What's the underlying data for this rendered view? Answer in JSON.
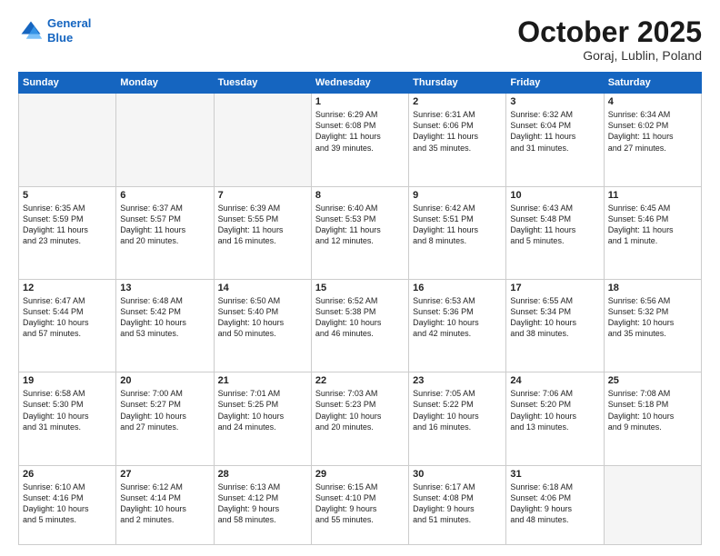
{
  "logo": {
    "line1": "General",
    "line2": "Blue"
  },
  "header": {
    "month": "October 2025",
    "location": "Goraj, Lublin, Poland"
  },
  "weekdays": [
    "Sunday",
    "Monday",
    "Tuesday",
    "Wednesday",
    "Thursday",
    "Friday",
    "Saturday"
  ],
  "weeks": [
    [
      {
        "day": "",
        "content": ""
      },
      {
        "day": "",
        "content": ""
      },
      {
        "day": "",
        "content": ""
      },
      {
        "day": "1",
        "content": "Sunrise: 6:29 AM\nSunset: 6:08 PM\nDaylight: 11 hours\nand 39 minutes."
      },
      {
        "day": "2",
        "content": "Sunrise: 6:31 AM\nSunset: 6:06 PM\nDaylight: 11 hours\nand 35 minutes."
      },
      {
        "day": "3",
        "content": "Sunrise: 6:32 AM\nSunset: 6:04 PM\nDaylight: 11 hours\nand 31 minutes."
      },
      {
        "day": "4",
        "content": "Sunrise: 6:34 AM\nSunset: 6:02 PM\nDaylight: 11 hours\nand 27 minutes."
      }
    ],
    [
      {
        "day": "5",
        "content": "Sunrise: 6:35 AM\nSunset: 5:59 PM\nDaylight: 11 hours\nand 23 minutes."
      },
      {
        "day": "6",
        "content": "Sunrise: 6:37 AM\nSunset: 5:57 PM\nDaylight: 11 hours\nand 20 minutes."
      },
      {
        "day": "7",
        "content": "Sunrise: 6:39 AM\nSunset: 5:55 PM\nDaylight: 11 hours\nand 16 minutes."
      },
      {
        "day": "8",
        "content": "Sunrise: 6:40 AM\nSunset: 5:53 PM\nDaylight: 11 hours\nand 12 minutes."
      },
      {
        "day": "9",
        "content": "Sunrise: 6:42 AM\nSunset: 5:51 PM\nDaylight: 11 hours\nand 8 minutes."
      },
      {
        "day": "10",
        "content": "Sunrise: 6:43 AM\nSunset: 5:48 PM\nDaylight: 11 hours\nand 5 minutes."
      },
      {
        "day": "11",
        "content": "Sunrise: 6:45 AM\nSunset: 5:46 PM\nDaylight: 11 hours\nand 1 minute."
      }
    ],
    [
      {
        "day": "12",
        "content": "Sunrise: 6:47 AM\nSunset: 5:44 PM\nDaylight: 10 hours\nand 57 minutes."
      },
      {
        "day": "13",
        "content": "Sunrise: 6:48 AM\nSunset: 5:42 PM\nDaylight: 10 hours\nand 53 minutes."
      },
      {
        "day": "14",
        "content": "Sunrise: 6:50 AM\nSunset: 5:40 PM\nDaylight: 10 hours\nand 50 minutes."
      },
      {
        "day": "15",
        "content": "Sunrise: 6:52 AM\nSunset: 5:38 PM\nDaylight: 10 hours\nand 46 minutes."
      },
      {
        "day": "16",
        "content": "Sunrise: 6:53 AM\nSunset: 5:36 PM\nDaylight: 10 hours\nand 42 minutes."
      },
      {
        "day": "17",
        "content": "Sunrise: 6:55 AM\nSunset: 5:34 PM\nDaylight: 10 hours\nand 38 minutes."
      },
      {
        "day": "18",
        "content": "Sunrise: 6:56 AM\nSunset: 5:32 PM\nDaylight: 10 hours\nand 35 minutes."
      }
    ],
    [
      {
        "day": "19",
        "content": "Sunrise: 6:58 AM\nSunset: 5:30 PM\nDaylight: 10 hours\nand 31 minutes."
      },
      {
        "day": "20",
        "content": "Sunrise: 7:00 AM\nSunset: 5:27 PM\nDaylight: 10 hours\nand 27 minutes."
      },
      {
        "day": "21",
        "content": "Sunrise: 7:01 AM\nSunset: 5:25 PM\nDaylight: 10 hours\nand 24 minutes."
      },
      {
        "day": "22",
        "content": "Sunrise: 7:03 AM\nSunset: 5:23 PM\nDaylight: 10 hours\nand 20 minutes."
      },
      {
        "day": "23",
        "content": "Sunrise: 7:05 AM\nSunset: 5:22 PM\nDaylight: 10 hours\nand 16 minutes."
      },
      {
        "day": "24",
        "content": "Sunrise: 7:06 AM\nSunset: 5:20 PM\nDaylight: 10 hours\nand 13 minutes."
      },
      {
        "day": "25",
        "content": "Sunrise: 7:08 AM\nSunset: 5:18 PM\nDaylight: 10 hours\nand 9 minutes."
      }
    ],
    [
      {
        "day": "26",
        "content": "Sunrise: 6:10 AM\nSunset: 4:16 PM\nDaylight: 10 hours\nand 5 minutes."
      },
      {
        "day": "27",
        "content": "Sunrise: 6:12 AM\nSunset: 4:14 PM\nDaylight: 10 hours\nand 2 minutes."
      },
      {
        "day": "28",
        "content": "Sunrise: 6:13 AM\nSunset: 4:12 PM\nDaylight: 9 hours\nand 58 minutes."
      },
      {
        "day": "29",
        "content": "Sunrise: 6:15 AM\nSunset: 4:10 PM\nDaylight: 9 hours\nand 55 minutes."
      },
      {
        "day": "30",
        "content": "Sunrise: 6:17 AM\nSunset: 4:08 PM\nDaylight: 9 hours\nand 51 minutes."
      },
      {
        "day": "31",
        "content": "Sunrise: 6:18 AM\nSunset: 4:06 PM\nDaylight: 9 hours\nand 48 minutes."
      },
      {
        "day": "",
        "content": ""
      }
    ]
  ]
}
